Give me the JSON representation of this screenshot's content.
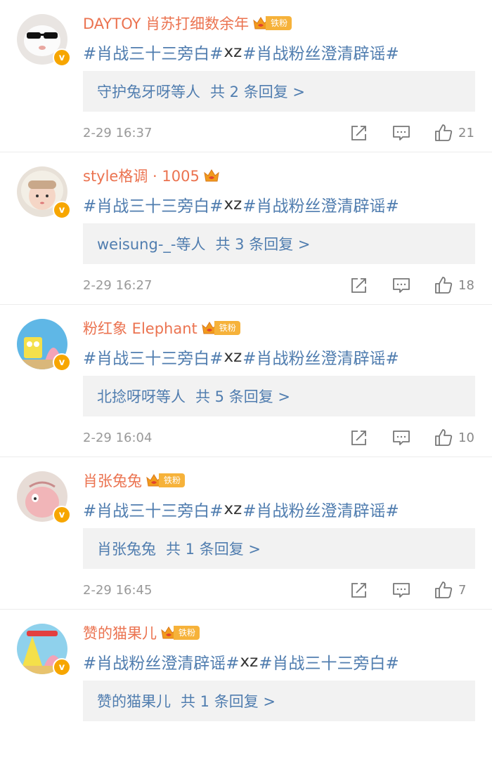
{
  "comments": [
    {
      "username": "DAYTOY 肖苏打细数余年",
      "fan_tag": "铁粉",
      "content": [
        "#肖战三十三旁白#",
        " xz",
        "#肖战粉丝澄清辟谣#"
      ],
      "reply_users": "守护兔牙呀等人",
      "reply_count": "共 2 条回复 >",
      "time": "2-29 16:37",
      "likes": "21"
    },
    {
      "username": "style格调 · 1005",
      "fan_tag": "",
      "content": [
        "#肖战三十三旁白#",
        " xz",
        "#肖战粉丝澄清辟谣#"
      ],
      "reply_users": "weisung-_-等人",
      "reply_count": "共 3 条回复 >",
      "time": "2-29 16:27",
      "likes": "18"
    },
    {
      "username": "粉红象 Elephant",
      "fan_tag": "铁粉",
      "content": [
        "#肖战三十三旁白#",
        " xz",
        "#肖战粉丝澄清辟谣#"
      ],
      "reply_users": "北捻呀呀等人",
      "reply_count": "共 5 条回复 >",
      "time": "2-29 16:04",
      "likes": "10"
    },
    {
      "username": "肖张兔兔",
      "fan_tag": "铁粉",
      "content": [
        "#肖战三十三旁白#",
        " xz",
        "#肖战粉丝澄清辟谣#"
      ],
      "reply_users": "肖张兔兔",
      "reply_count": "共 1 条回复 >",
      "time": "2-29 16:45",
      "likes": "7"
    },
    {
      "username": "赞的猫果儿",
      "fan_tag": "铁粉",
      "content": [
        "#肖战粉丝澄清辟谣#",
        " xz",
        "#肖战三十三旁白#"
      ],
      "reply_users": "赞的猫果儿",
      "reply_count": "共 1 条回复 >",
      "time": "",
      "likes": ""
    }
  ],
  "colors": {
    "username": "#eb7350",
    "link": "#507daf",
    "badge": "#f7a600",
    "reply_bg": "#f2f2f2"
  },
  "icons": [
    "verified-v-icon",
    "crown-icon",
    "share-icon",
    "comment-icon",
    "thumbs-up-icon"
  ]
}
